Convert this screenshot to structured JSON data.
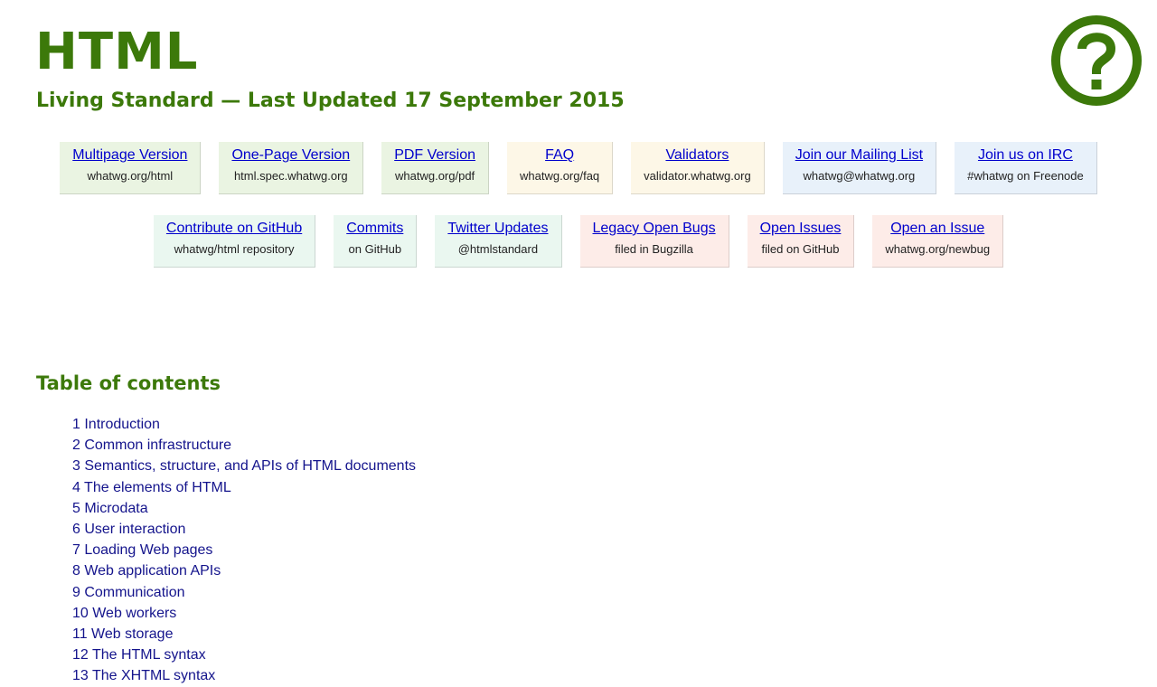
{
  "header": {
    "title": "HTML",
    "subtitle": "Living Standard — Last Updated 17 September 2015",
    "logo_icon": "question-mark-circle-icon",
    "accent_color": "#3c790a"
  },
  "links_row1": [
    {
      "label": "Multipage Version",
      "sub": "whatwg.org/html"
    },
    {
      "label": "One-Page Version",
      "sub": "html.spec.whatwg.org"
    },
    {
      "label": "PDF Version",
      "sub": "whatwg.org/pdf"
    },
    {
      "label": "FAQ",
      "sub": "whatwg.org/faq"
    },
    {
      "label": "Validators",
      "sub": "validator.whatwg.org"
    },
    {
      "label": "Join our Mailing List",
      "sub": "whatwg@whatwg.org"
    },
    {
      "label": "Join us on IRC",
      "sub": "#whatwg on Freenode"
    }
  ],
  "links_row2": [
    {
      "label": "Contribute on GitHub",
      "sub": "whatwg/html repository"
    },
    {
      "label": "Commits",
      "sub": "on GitHub"
    },
    {
      "label": "Twitter Updates",
      "sub": "@htmlstandard"
    },
    {
      "label": "Legacy Open Bugs",
      "sub": "filed in Bugzilla"
    },
    {
      "label": "Open Issues",
      "sub": "filed on GitHub"
    },
    {
      "label": "Open an Issue",
      "sub": "whatwg.org/newbug"
    }
  ],
  "toc": {
    "heading": "Table of contents",
    "items": [
      "1 Introduction",
      "2 Common infrastructure",
      "3 Semantics, structure, and APIs of HTML documents",
      "4 The elements of HTML",
      "5 Microdata",
      "6 User interaction",
      "7 Loading Web pages",
      "8 Web application APIs",
      "9 Communication",
      "10 Web workers",
      "11 Web storage",
      "12 The HTML syntax",
      "13 The XHTML syntax"
    ]
  },
  "colors": {
    "link": "#0000cc",
    "toc_link": "#14148c",
    "box_green": "#eaf4e2",
    "box_yellow": "#fdf7e7",
    "box_blue": "#e8f1fa",
    "box_mint": "#eaf7f0",
    "box_pink": "#fdece8"
  }
}
